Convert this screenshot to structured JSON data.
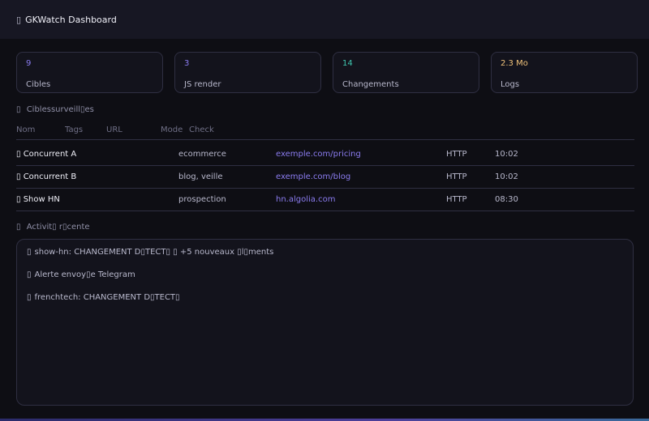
{
  "header": {
    "icon": "eye-icon",
    "glyph": "▯",
    "title": "GKWatch Dashboard"
  },
  "stats": [
    {
      "value": "9",
      "label": "Cibles",
      "color": "#8b7cf0"
    },
    {
      "value": "3",
      "label": "JS render",
      "color": "#8b7cf0"
    },
    {
      "value": "14",
      "label": "Changements",
      "color": "#3fc7b0"
    },
    {
      "value": "2.3 Mo",
      "label": "Logs",
      "color": "#f0c27a"
    }
  ],
  "targets": {
    "glyph": "▯",
    "title": "Ciblessurveill▯es",
    "columns": [
      "Nom",
      "Tags",
      "URL",
      "Mode",
      "Check"
    ],
    "rows": [
      {
        "glyph": "▯",
        "name": "Concurrent A",
        "tags": "ecommerce",
        "url": "exemple.com/pricing",
        "mode": "HTTP",
        "check": "10:02"
      },
      {
        "glyph": "▯",
        "name": "Concurrent B",
        "tags": "blog, veille",
        "url": "exemple.com/blog",
        "mode": "HTTP",
        "check": "10:02"
      },
      {
        "glyph": "▯",
        "name": "Show HN",
        "tags": "prospection",
        "url": "hn.algolia.com",
        "mode": "HTTP",
        "check": "08:30"
      }
    ]
  },
  "activity": {
    "glyph": "▯",
    "title": "Activit▯ r▯cente",
    "items": [
      {
        "glyph": "▯",
        "text": "show-hn: CHANGEMENT D▯TECT▯ ▯ +5 nouveaux ▯l▯ments"
      },
      {
        "glyph": "▯",
        "text": "Alerte envoy▯e Telegram"
      },
      {
        "glyph": "▯",
        "text": "frenchtech: CHANGEMENT D▯TECT▯"
      }
    ]
  }
}
